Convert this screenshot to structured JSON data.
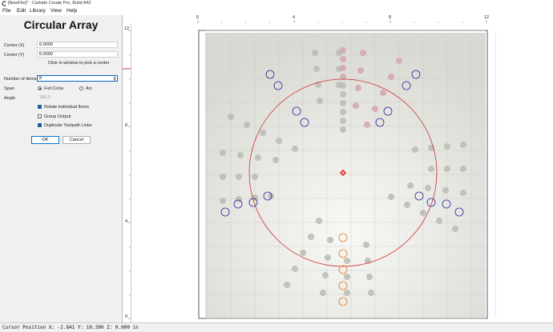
{
  "window": {
    "title": "[NewFile]* - Carbide Create Pro, Build 843"
  },
  "menu": [
    "File",
    "Edit",
    "Library",
    "View",
    "Help"
  ],
  "panel": {
    "heading": "Circular Array",
    "center_x_label": "Center (X)",
    "center_x_value": "6.0000",
    "center_y_label": "Center (Y)",
    "center_y_value": "6.0000",
    "pick_hint": "Click in window to pick a center",
    "items_label": "Number of Items",
    "items_value": "8",
    "span_label": "Span",
    "span_options": [
      "Full Circle",
      "Arc"
    ],
    "span_selected": "Full Circle",
    "angle_label": "Angle",
    "angle_value": "180.0",
    "rotate_label": "Rotate Individual Items",
    "rotate_checked": true,
    "group_label": "Group Output",
    "group_checked": false,
    "duplicate_label": "Duplicate Toolpath Links",
    "duplicate_checked": true,
    "ok_label": "OK",
    "cancel_label": "Cancel"
  },
  "ruler_x_ticks": [
    "0",
    "4",
    "8",
    "12"
  ],
  "ruler_y_ticks": [
    "12",
    "8",
    "4",
    "0"
  ],
  "colors": {
    "selection_circle": "#cc3333",
    "blue_circles": "#2a2a9a",
    "orange_circles": "#e07a2a",
    "center_marker": "#dd2222",
    "panel_bg": "#f0f0f0",
    "checkbox_on": "#1f5fa8"
  },
  "status": {
    "cursor": "Cursor Position X: -2.841 Y: 10.390 Z: 0.000 in"
  }
}
